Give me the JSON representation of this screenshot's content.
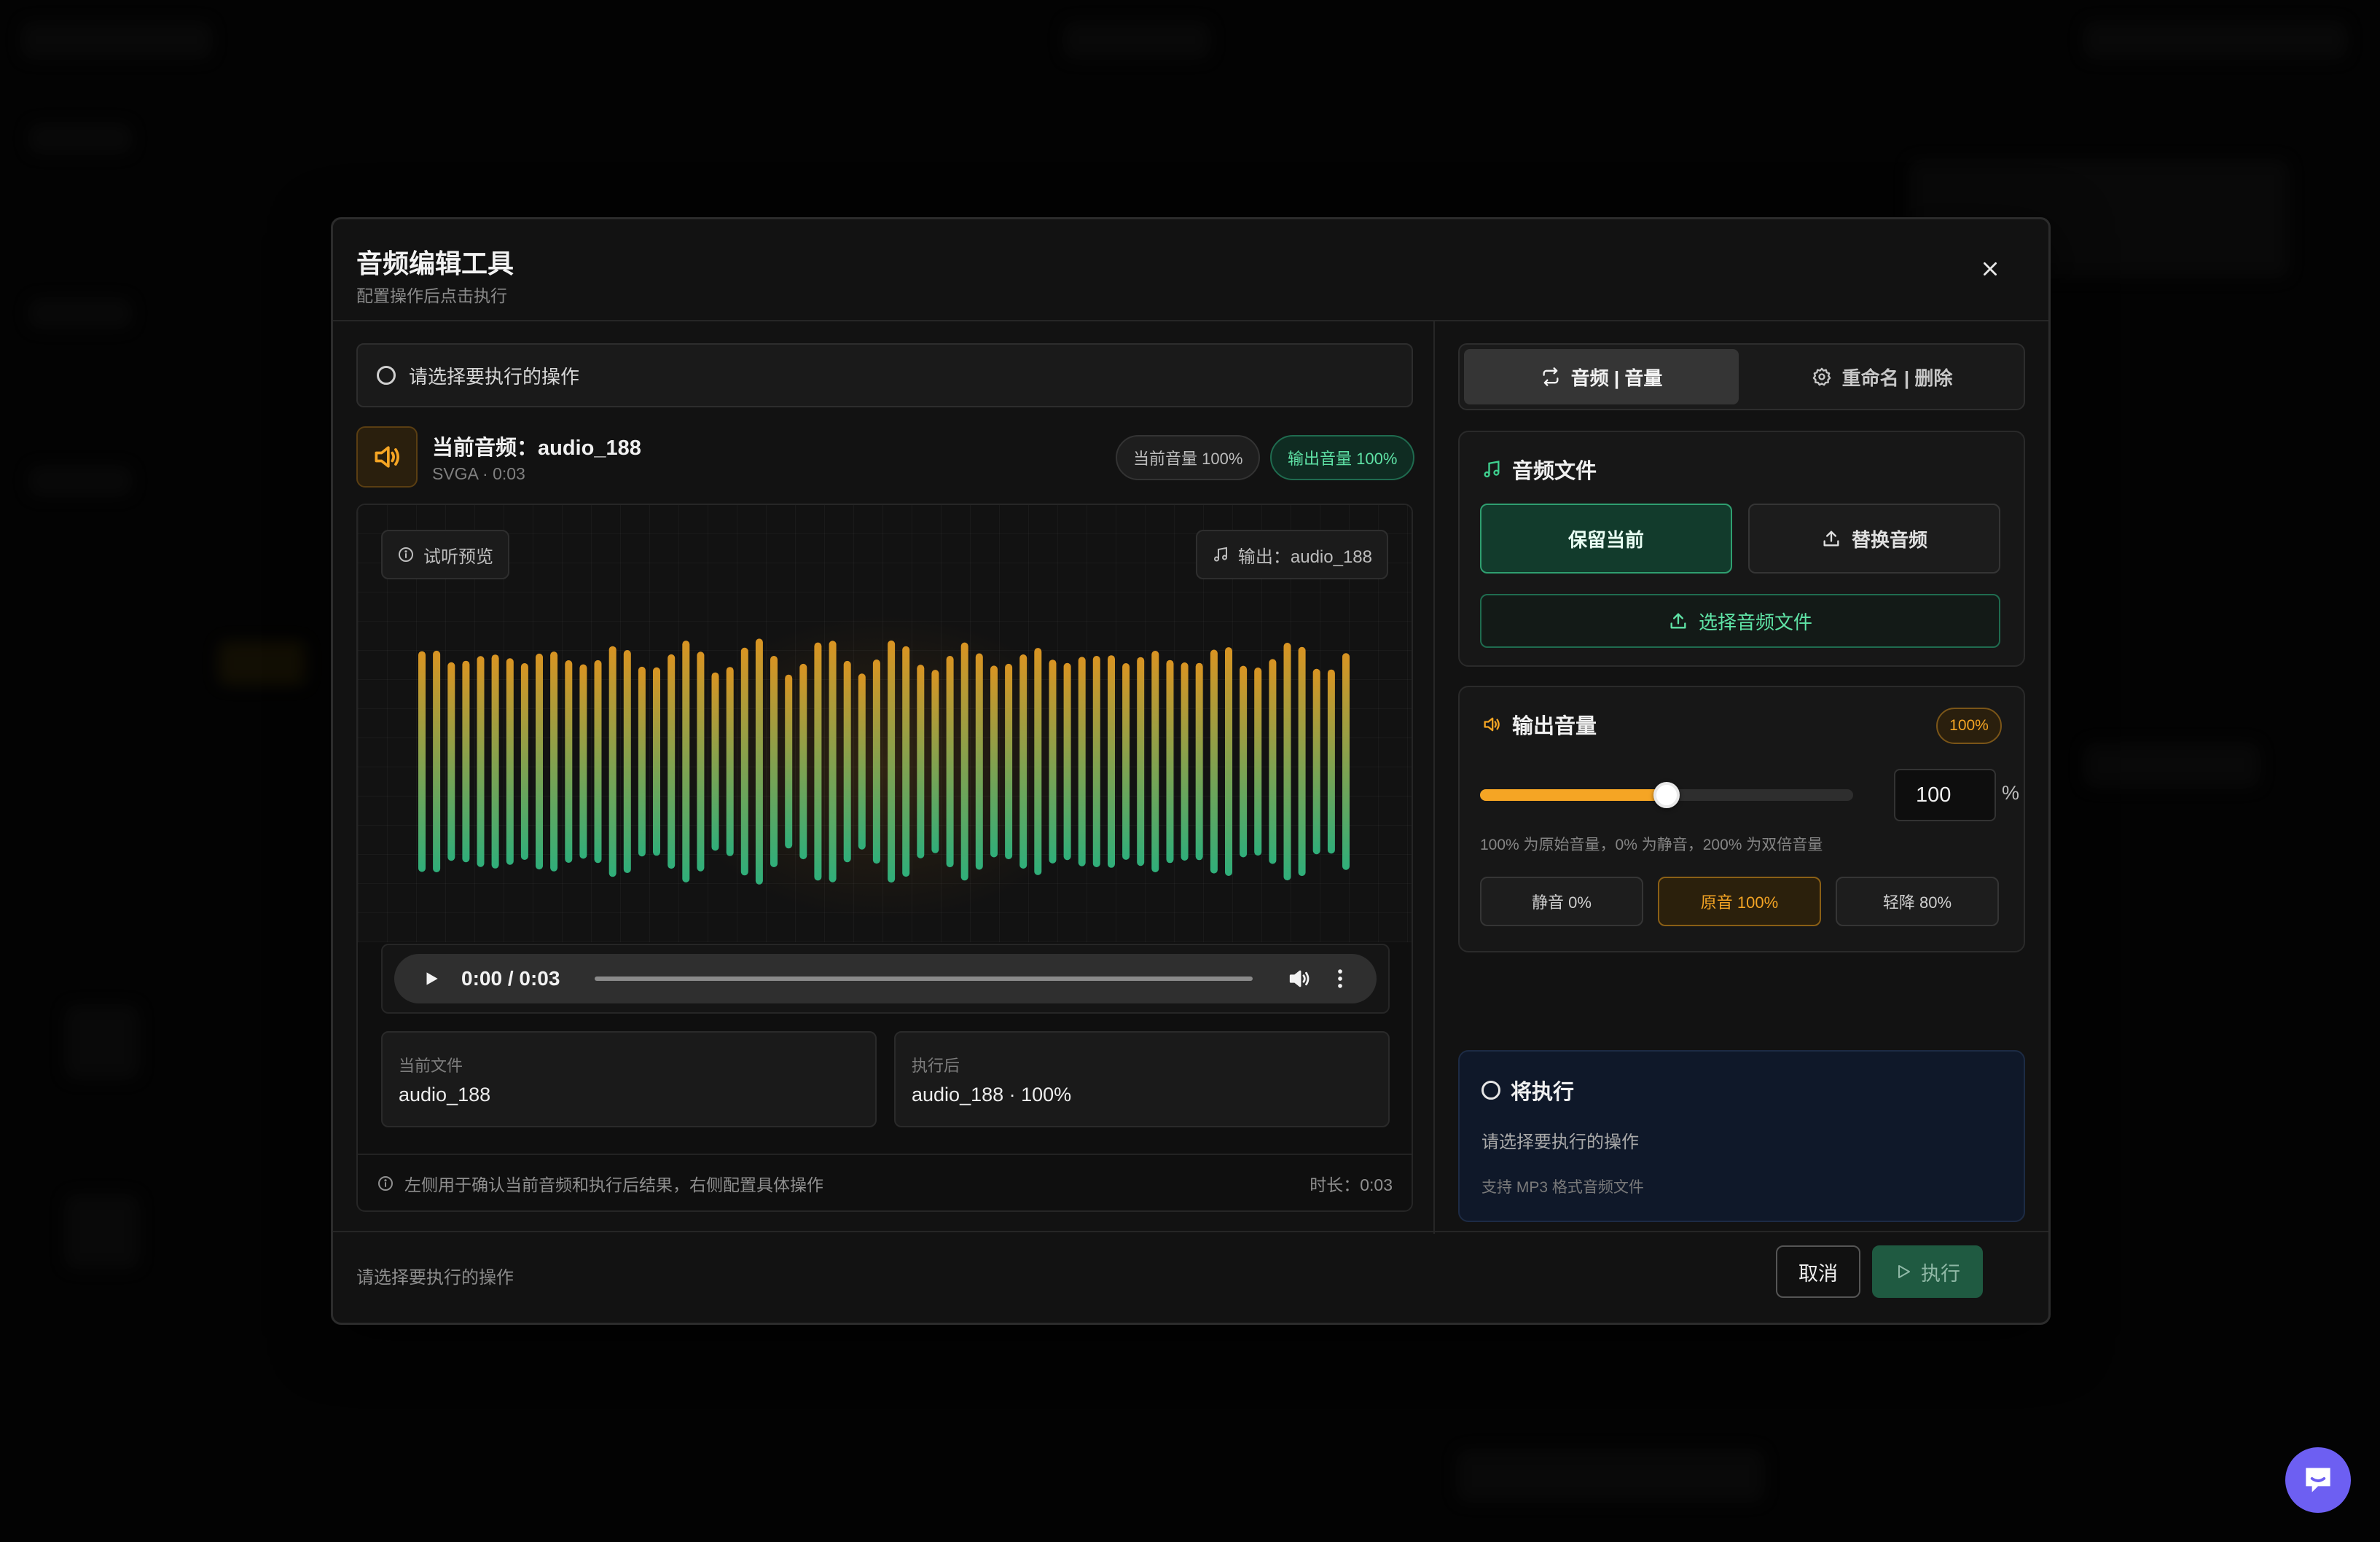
{
  "modal": {
    "title": "音频编辑工具",
    "subtitle": "配置操作后点击执行"
  },
  "operation_select": {
    "placeholder": "请选择要执行的操作"
  },
  "current_audio": {
    "label": "当前音频：audio_188",
    "meta": "SVGA · 0:03",
    "current_volume_pill": "当前音量 100%",
    "output_volume_pill": "输出音量 100%"
  },
  "preview": {
    "chip_label": "试听预览",
    "output_chip": "输出：audio_188",
    "player_time": "0:00 / 0:03",
    "waveform_colors": {
      "top": "#d99422",
      "bottom": "#2fae7a"
    }
  },
  "info_cards": [
    {
      "label": "当前文件",
      "value": "audio_188"
    },
    {
      "label": "执行后",
      "value": "audio_188 · 100%"
    }
  ],
  "footer_note": {
    "text": "左侧用于确认当前音频和执行后结果，右侧配置具体操作",
    "duration": "时长：0:03"
  },
  "tabs": [
    {
      "label": "音频 | 音量",
      "icon": "swap-icon",
      "active": true
    },
    {
      "label": "重命名 | 删除",
      "icon": "gear-icon",
      "active": false
    }
  ],
  "audio_file_card": {
    "title": "音频文件",
    "keep_current": "保留当前",
    "replace_audio": "替换音频",
    "choose_file": "选择音频文件"
  },
  "volume_card": {
    "title": "输出音量",
    "badge": "100%",
    "input_value": "100",
    "unit": "%",
    "slider_level_percent": 100,
    "slider_max_percent": 200,
    "hint": "100% 为原始音量，0% 为静音，200% 为双倍音量",
    "presets": [
      {
        "label": "静音 0%",
        "active": false
      },
      {
        "label": "原音 100%",
        "active": true
      },
      {
        "label": "轻降 80%",
        "active": false
      }
    ]
  },
  "will_execute_card": {
    "title": "将执行",
    "line1": "请选择要执行的操作",
    "line2": "支持 MP3 格式音频文件"
  },
  "footer": {
    "status": "请选择要执行的操作",
    "cancel": "取消",
    "execute": "执行"
  },
  "colors": {
    "accent_orange": "#f5a524",
    "accent_green": "#3fd08f",
    "execute_bg": "#1f5a41"
  }
}
